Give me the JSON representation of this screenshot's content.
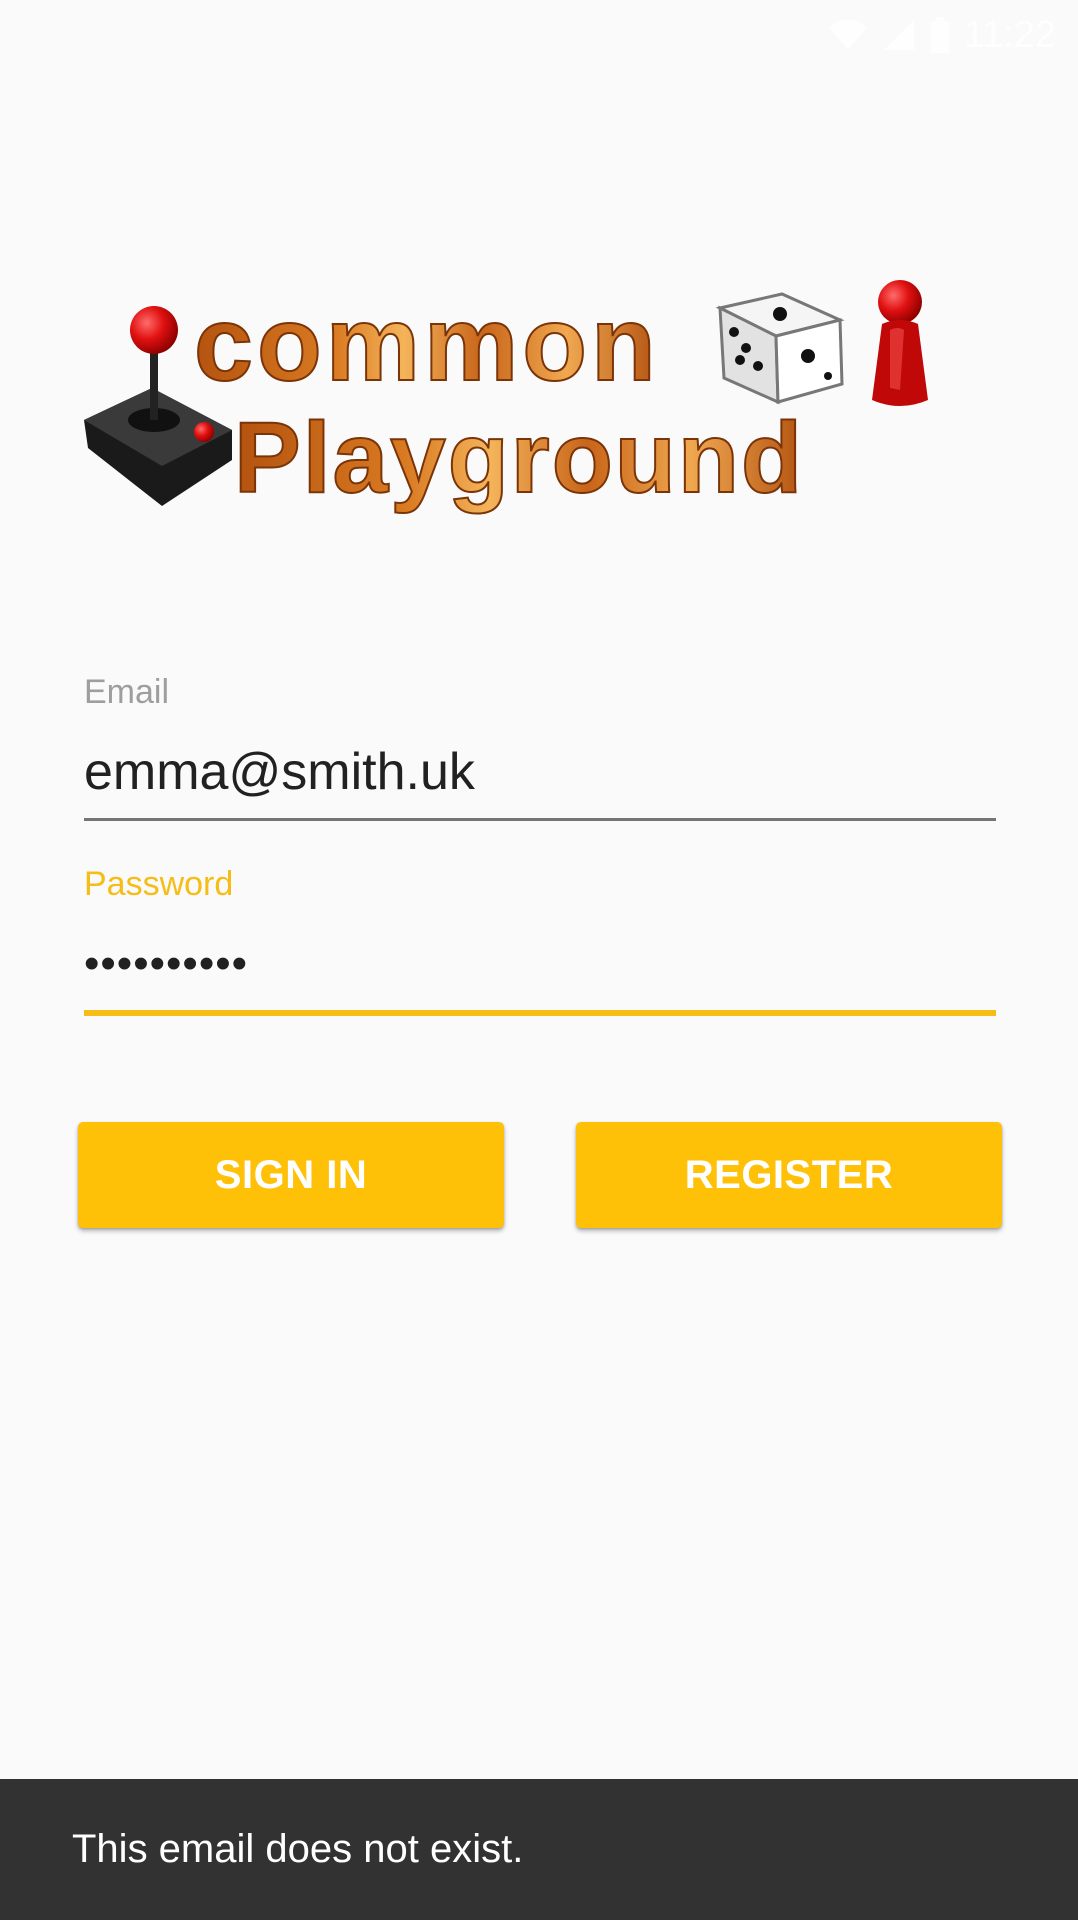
{
  "status_bar": {
    "time": "11:22",
    "icons": [
      "wifi-icon",
      "signal-icon",
      "battery-icon"
    ]
  },
  "logo": {
    "line1": "common",
    "line2": "Playground",
    "icons": [
      "joystick-icon",
      "dice-icon",
      "game-pawn-icon"
    ]
  },
  "form": {
    "email": {
      "label": "Email",
      "value": "emma@smith.uk"
    },
    "password": {
      "label": "Password",
      "value": "••••••••••"
    }
  },
  "buttons": {
    "sign_in": "SIGN IN",
    "register": "REGISTER"
  },
  "snackbar": {
    "message": "This email does not exist."
  },
  "colors": {
    "accent": "#ffc107",
    "focus": "#f6bd16",
    "background": "#fafafa",
    "snackbar": "#323232"
  }
}
